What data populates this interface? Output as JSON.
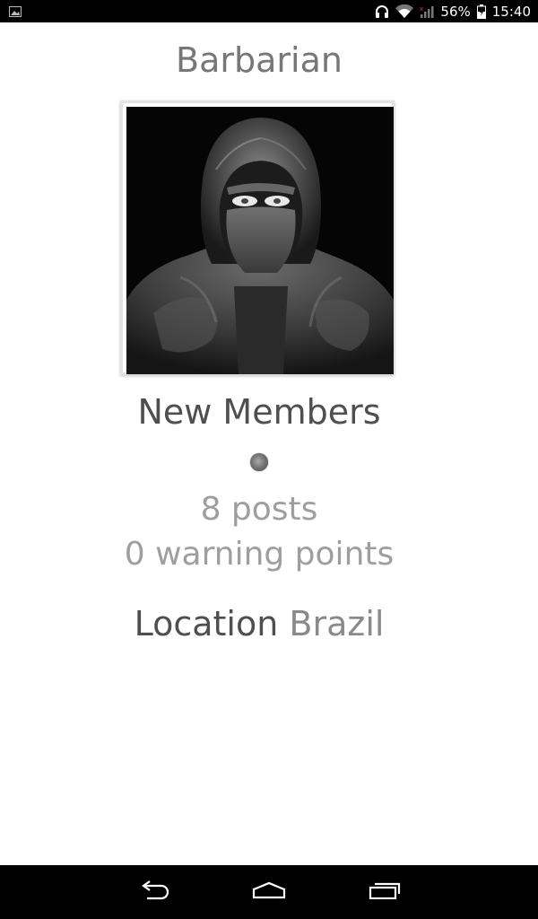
{
  "status_bar": {
    "battery": "56%",
    "time": "15:40",
    "icons": [
      "image-notification-icon",
      "headphones-icon",
      "wifi-icon",
      "signal-icon",
      "battery-icon"
    ]
  },
  "profile": {
    "username": "Barbarian",
    "avatar_description": "masked-warrior-avatar",
    "group": "New Members",
    "posts": "8 posts",
    "warning_points": "0 warning points",
    "location_label": "Location",
    "location_value": "Brazil"
  },
  "nav_bar": {
    "buttons": [
      "back-icon",
      "home-icon",
      "recent-apps-icon"
    ]
  },
  "colors": {
    "status_bar_bg": "#000000",
    "username": "#777777",
    "group": "#4f4f4f",
    "stats": "#9e9e9e"
  }
}
